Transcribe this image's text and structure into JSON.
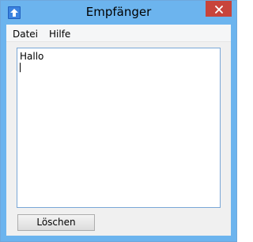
{
  "window": {
    "title": "Empfänger"
  },
  "menubar": {
    "items": [
      {
        "label": "Datei"
      },
      {
        "label": "Hilfe"
      }
    ]
  },
  "main": {
    "textarea_value": "Hallo",
    "clear_button_label": "Löschen"
  },
  "colors": {
    "titlebar": "#6cb4ee",
    "close_button": "#c8443b",
    "client_background": "#f0f0f0",
    "textarea_border": "#7aa7d6"
  },
  "icons": {
    "app": "upload-arrow-icon",
    "close": "close-icon"
  }
}
